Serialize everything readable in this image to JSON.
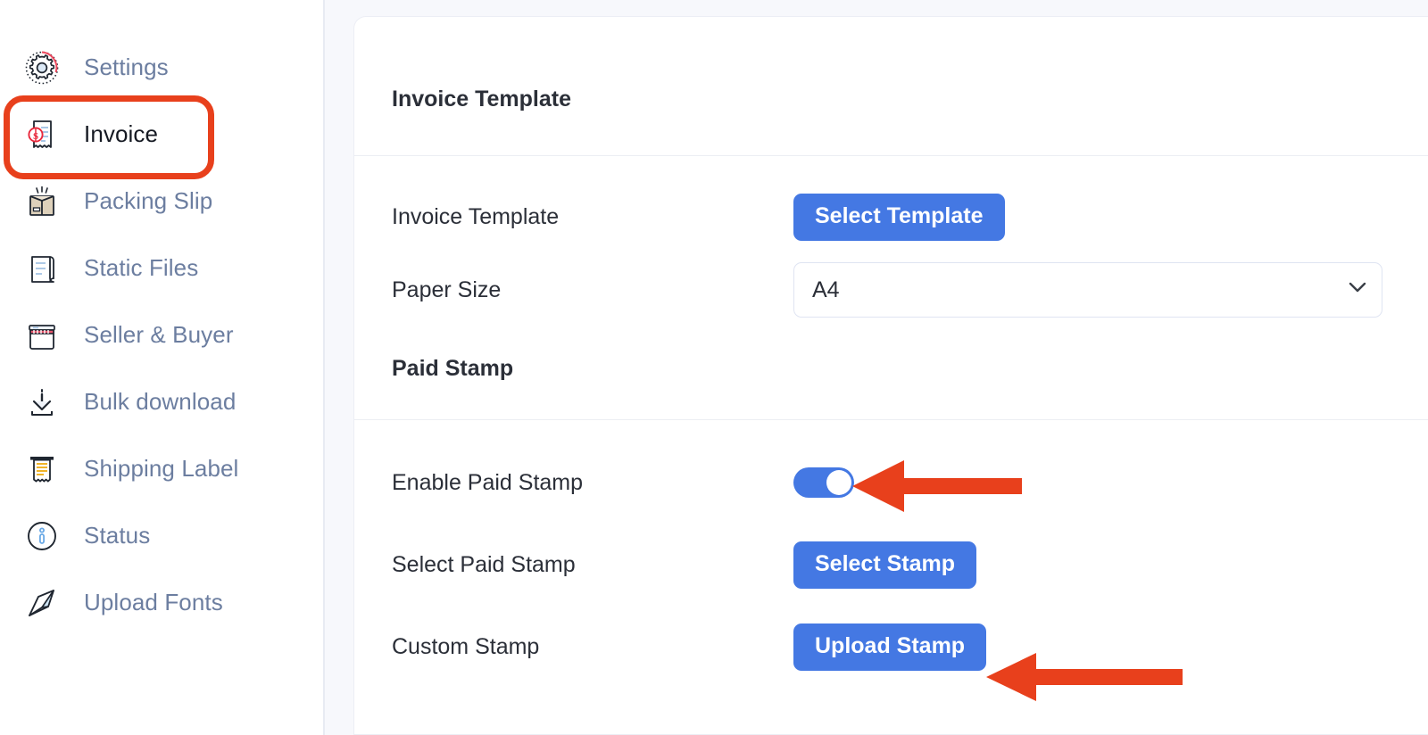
{
  "sidebar": {
    "items": [
      {
        "label": "Settings",
        "icon": "gear-icon",
        "active": false
      },
      {
        "label": "Invoice",
        "icon": "invoice-receipt-icon",
        "active": true
      },
      {
        "label": "Packing Slip",
        "icon": "open-box-icon",
        "active": false
      },
      {
        "label": "Static Files",
        "icon": "scroll-document-icon",
        "active": false
      },
      {
        "label": "Seller & Buyer",
        "icon": "storefront-icon",
        "active": false
      },
      {
        "label": "Bulk download",
        "icon": "download-arrow-icon",
        "active": false
      },
      {
        "label": "Shipping Label",
        "icon": "shipping-label-icon",
        "active": false
      },
      {
        "label": "Status",
        "icon": "info-circle-icon",
        "active": false
      },
      {
        "label": "Upload Fonts",
        "icon": "pen-nib-icon",
        "active": false
      }
    ]
  },
  "main": {
    "sections": [
      {
        "title": "Invoice Template",
        "rows": [
          {
            "label": "Invoice Template",
            "control": "button",
            "value": "Select Template"
          },
          {
            "label": "Paper Size",
            "control": "select",
            "value": "A4"
          }
        ]
      },
      {
        "title": "Paid Stamp",
        "rows": [
          {
            "label": "Enable Paid Stamp",
            "control": "toggle",
            "value": "on"
          },
          {
            "label": "Select Paid Stamp",
            "control": "button",
            "value": "Select Stamp"
          },
          {
            "label": "Custom Stamp",
            "control": "button",
            "value": "Upload Stamp"
          }
        ]
      }
    ]
  },
  "annotations": {
    "highlight_color": "#e8401c",
    "arrow_color": "#e8401c",
    "arrows": [
      {
        "name": "arrow-pointing-to-enable-paid-stamp-toggle",
        "direction": "left"
      },
      {
        "name": "arrow-pointing-to-upload-stamp-button",
        "direction": "left"
      }
    ]
  },
  "colors": {
    "accent_blue": "#4478e3",
    "sidebar_label": "#6c7ea0",
    "active_label": "#151922",
    "page_bg": "#f7f8fc",
    "card_bg": "#ffffff"
  }
}
